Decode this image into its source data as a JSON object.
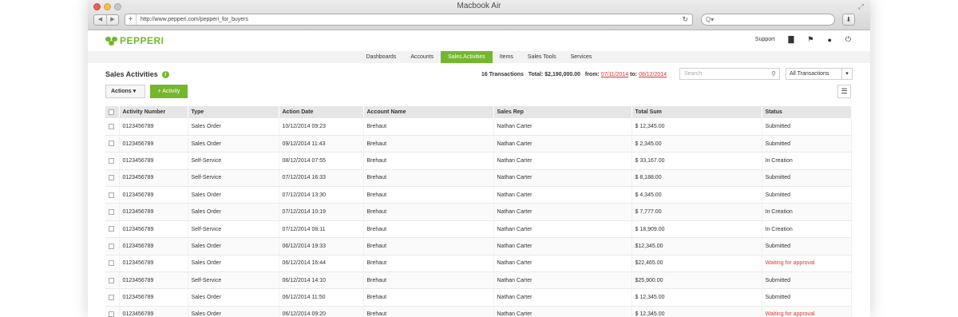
{
  "browser": {
    "window_title": "Macbook Air",
    "url": "http://www.pepperi.com/pepperi_for_buyers",
    "search_placeholder": "Q▾"
  },
  "app": {
    "logo_text": "PEPPERI",
    "support_label": "Support"
  },
  "tabs": [
    {
      "label": "Dashboards",
      "active": false
    },
    {
      "label": "Accounts",
      "active": false
    },
    {
      "label": "Sales Activities",
      "active": true
    },
    {
      "label": "Items",
      "active": false
    },
    {
      "label": "Sales Tools",
      "active": false
    },
    {
      "label": "Services",
      "active": false
    }
  ],
  "page": {
    "title": "Sales Activities",
    "transactions": "16 Transactions",
    "total": "Total: $2,190,000.00",
    "from_label": "from:",
    "from_date": "07/11/2014",
    "to_label": "to:",
    "to_date": "08/12/2014",
    "search_placeholder": "Search",
    "filter_value": "All Transactions",
    "actions_label": "Actions",
    "add_label": "+ Activity"
  },
  "table": {
    "columns": [
      "Activity Number",
      "Type",
      "Action Date",
      "Account Name",
      "Sales Rep",
      "Total Sum",
      "Status"
    ],
    "rows": [
      [
        "0123456789",
        "Sales Order",
        "10/12/2014  09:23",
        "Brehaut",
        "Nathan Carter",
        "$ 12,345.00",
        "Submitted"
      ],
      [
        "0123456789",
        "Sales Order",
        "09/12/2014  11:43",
        "Brehaut",
        "Nathan Carter",
        "$ 2,345.00",
        "Submitted"
      ],
      [
        "0123456789",
        "Self-Service",
        "08/12/2014  07:55",
        "Brehaut",
        "Nathan Carter",
        "$ 33,167.00",
        "In Creation"
      ],
      [
        "0123456789",
        "Self-Service",
        "07/12/2014  16:33",
        "Brehaut",
        "Nathan Carter",
        "$ 8,188.00",
        "Submitted"
      ],
      [
        "0123456789",
        "Sales Order",
        "07/12/2014  13:30",
        "Brehaut",
        "Nathan Carter",
        "$ 4,345.00",
        "Submitted"
      ],
      [
        "0123456789",
        "Sales Order",
        "07/12/2014  10:19",
        "Brehaut",
        "Nathan Carter",
        "$ 7,777.00",
        "In Creation"
      ],
      [
        "0123456789",
        "Self-Service",
        "07/12/2014  08:11",
        "Brehaut",
        "Nathan Carter",
        "$ 18,909.00",
        "In Creation"
      ],
      [
        "0123456789",
        "Sales Order",
        "06/12/2014  19:33",
        "Brehaut",
        "Nathan Carter",
        "$12,345.00",
        "Submitted"
      ],
      [
        "0123456789",
        "Sales Order",
        "06/12/2014  16:44",
        "Brehaut",
        "Nathan Carter",
        "$22,465.00",
        "Waiting for approval"
      ],
      [
        "0123456789",
        "Self-Service",
        "06/12/2014  14:10",
        "Brehaut",
        "Nathan Carter",
        "$25,900.00",
        "Submitted"
      ],
      [
        "0123456789",
        "Sales Order",
        "06/12/2014  11:50",
        "Brehaut",
        "Nathan Carter",
        "$ 12,345.00",
        "Submitted"
      ],
      [
        "0123456789",
        "Sales Order",
        "06/12/2014  09:20",
        "Brehaut",
        "Nathan Carter",
        "$ 12,345.00",
        "Waiting for approval"
      ]
    ]
  },
  "colors": {
    "accent": "#74b72e",
    "date_red": "#d9362b",
    "status_waiting": "#e0392b"
  }
}
